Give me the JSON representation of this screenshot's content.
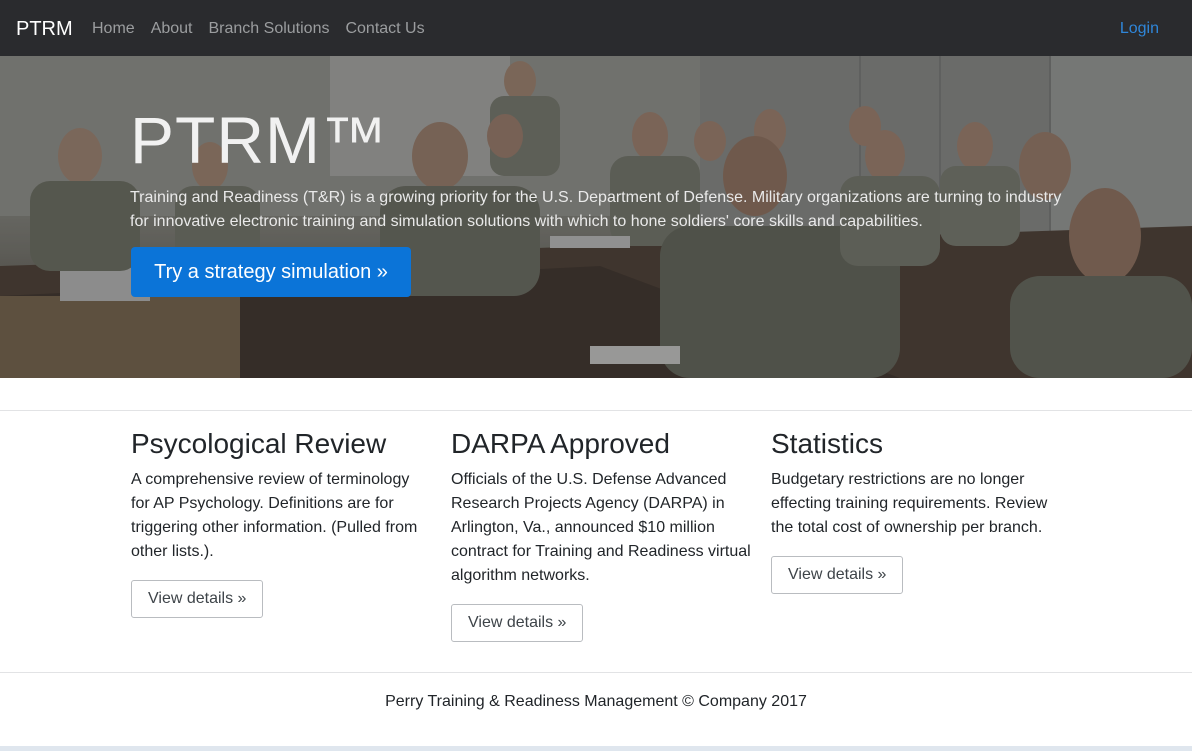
{
  "navbar": {
    "brand": "PTRM",
    "links": [
      "Home",
      "About",
      "Branch Solutions",
      "Contact Us"
    ],
    "login": "Login"
  },
  "hero": {
    "title": "PTRM™",
    "text": "Training and Readiness (T&R) is a growing priority for the U.S. Department of Defense. Military organizations are turning to industry for innovative electronic training and simulation solutions with which to hone soldiers' core skills and capabilities.",
    "button": "Try a strategy simulation »"
  },
  "columns": [
    {
      "heading": "Psycological Review",
      "text": "A comprehensive review of terminology for AP Psychology. Definitions are for triggering other information. (Pulled from other lists.).",
      "button": "View details »"
    },
    {
      "heading": "DARPA Approved",
      "text": "Officials of the U.S. Defense Advanced Research Projects Agency (DARPA) in Arlington, Va., announced $10 million contract for Training and Readiness virtual algorithm networks.",
      "button": "View details »"
    },
    {
      "heading": "Statistics",
      "text": "Budgetary restrictions are no longer effecting training requirements. Review the total cost of ownership per branch.",
      "button": "View details »"
    }
  ],
  "footer": {
    "text": "Perry Training & Readiness Management © Company 2017"
  },
  "colors": {
    "navbar_bg": "#2a2b2e",
    "accent": "#0b74d8",
    "login_link": "#2f86d9"
  }
}
